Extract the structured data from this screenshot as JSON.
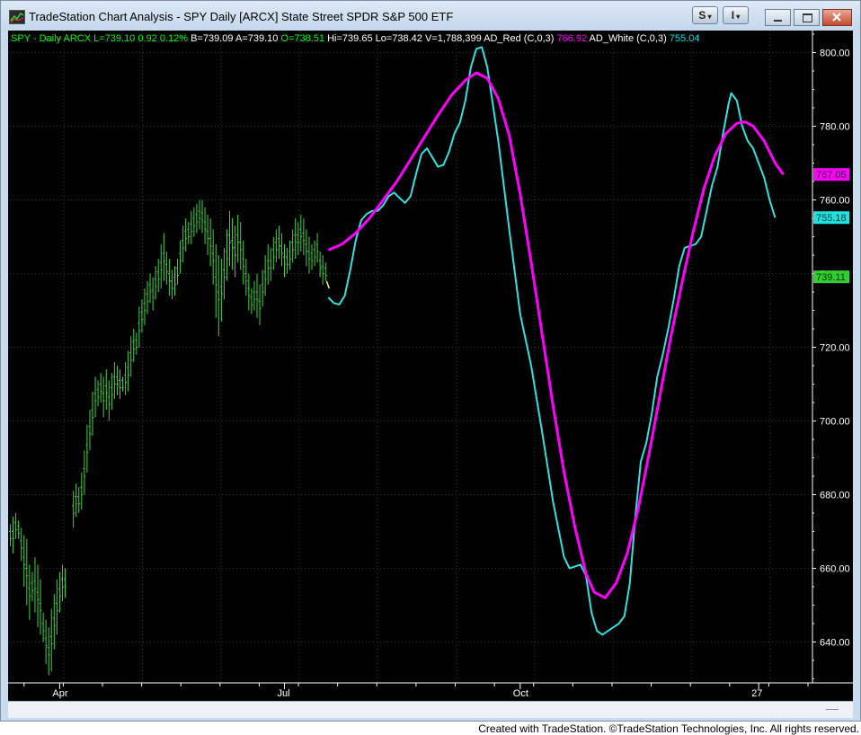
{
  "window": {
    "title": "TradeStation Chart Analysis - SPY Daily [ARCX] State Street SPDR S&P 500 ETF",
    "buttons": {
      "s_menu": "S",
      "i_menu": "I"
    }
  },
  "status_line": [
    {
      "text": "SPY - Daily",
      "color": "#00ff00"
    },
    {
      "text": "ARCX",
      "color": "#00ff00"
    },
    {
      "text": "L=739.10",
      "color": "#00ff00"
    },
    {
      "text": "0.92",
      "color": "#00ff00"
    },
    {
      "text": "0.12%",
      "color": "#00ff00"
    },
    {
      "text": "B=739.09",
      "color": "#ffffff"
    },
    {
      "text": "A=739.10",
      "color": "#ffffff"
    },
    {
      "text": "O=738.51",
      "color": "#00ff00"
    },
    {
      "text": "Hi=739.65",
      "color": "#ffffff"
    },
    {
      "text": "Lo=738.42",
      "color": "#ffffff"
    },
    {
      "text": "V=1,788,399",
      "color": "#ffffff"
    },
    {
      "text": "AD_Red (C,0,3)",
      "color": "#ffffff"
    },
    {
      "text": "766.92",
      "color": "#ff00ff"
    },
    {
      "text": "AD_White (C,0,3)",
      "color": "#ffffff"
    },
    {
      "text": "755.04",
      "color": "#00e5e5"
    }
  ],
  "credit": "Created with TradeStation. ©TradeStation Technologies, Inc. All rights reserved.",
  "colors": {
    "price": "#3fd43f",
    "last_bar": "#ffff66",
    "red": "#ff00ff",
    "white": "#33e0e0",
    "grid": "#1f3f3f"
  },
  "chart_data": {
    "type": "line",
    "symbol": "SPY",
    "interval": "Daily",
    "y_ticks": [
      800,
      780,
      760,
      740,
      720,
      700,
      680,
      660,
      640
    ],
    "y_tick_labels": [
      "800.00",
      "780.00",
      "760.00",
      "740.00",
      "720.00",
      "700.00",
      "680.00",
      "660.00",
      "640.00"
    ],
    "ylim": [
      628,
      806
    ],
    "x_ticks": [
      {
        "label": "Apr",
        "bar": 18
      },
      {
        "label": "Jul",
        "bar": 100
      },
      {
        "label": "Oct",
        "bar": 186
      },
      {
        "label": "27",
        "bar": 273
      }
    ],
    "xlim": [
      0,
      292
    ],
    "grid": true,
    "price_bars": [
      {
        "bar": 0,
        "high": 672,
        "low": 666
      },
      {
        "bar": 1,
        "high": 674,
        "low": 664
      },
      {
        "bar": 2,
        "high": 675,
        "low": 668
      },
      {
        "bar": 3,
        "high": 673,
        "low": 668
      },
      {
        "bar": 4,
        "high": 671,
        "low": 662
      },
      {
        "bar": 5,
        "high": 669,
        "low": 655
      },
      {
        "bar": 6,
        "high": 668,
        "low": 650
      },
      {
        "bar": 7,
        "high": 661,
        "low": 646
      },
      {
        "bar": 8,
        "high": 659,
        "low": 651
      },
      {
        "bar": 9,
        "high": 663,
        "low": 648
      },
      {
        "bar": 10,
        "high": 661,
        "low": 644
      },
      {
        "bar": 11,
        "high": 657,
        "low": 642
      },
      {
        "bar": 12,
        "high": 648,
        "low": 640
      },
      {
        "bar": 13,
        "high": 646,
        "low": 634
      },
      {
        "bar": 14,
        "high": 644,
        "low": 631
      },
      {
        "bar": 15,
        "high": 649,
        "low": 632
      },
      {
        "bar": 16,
        "high": 653,
        "low": 638
      },
      {
        "bar": 17,
        "high": 657,
        "low": 642
      },
      {
        "bar": 18,
        "high": 659,
        "low": 648
      },
      {
        "bar": 19,
        "high": 661,
        "low": 651
      },
      {
        "bar": 20,
        "high": 660,
        "low": 652
      },
      {
        "bar": 23,
        "high": 681,
        "low": 671
      },
      {
        "bar": 24,
        "high": 683,
        "low": 674
      },
      {
        "bar": 25,
        "high": 682,
        "low": 675
      },
      {
        "bar": 26,
        "high": 686,
        "low": 676
      },
      {
        "bar": 27,
        "high": 692,
        "low": 680
      },
      {
        "bar": 28,
        "high": 699,
        "low": 686
      },
      {
        "bar": 29,
        "high": 703,
        "low": 692
      },
      {
        "bar": 30,
        "high": 708,
        "low": 696
      },
      {
        "bar": 31,
        "high": 712,
        "low": 701
      },
      {
        "bar": 32,
        "high": 711,
        "low": 704
      },
      {
        "bar": 33,
        "high": 713,
        "low": 705
      },
      {
        "bar": 34,
        "high": 712,
        "low": 701
      },
      {
        "bar": 35,
        "high": 714,
        "low": 703
      },
      {
        "bar": 36,
        "high": 711,
        "low": 700
      },
      {
        "bar": 37,
        "high": 713,
        "low": 703
      },
      {
        "bar": 38,
        "high": 716,
        "low": 706
      },
      {
        "bar": 39,
        "high": 715,
        "low": 707
      },
      {
        "bar": 40,
        "high": 714,
        "low": 706
      },
      {
        "bar": 41,
        "high": 712,
        "low": 708
      },
      {
        "bar": 42,
        "high": 716,
        "low": 707
      },
      {
        "bar": 43,
        "high": 719,
        "low": 708
      },
      {
        "bar": 44,
        "high": 723,
        "low": 712
      },
      {
        "bar": 45,
        "high": 725,
        "low": 716
      },
      {
        "bar": 46,
        "high": 724,
        "low": 718
      },
      {
        "bar": 47,
        "high": 731,
        "low": 720
      },
      {
        "bar": 48,
        "high": 733,
        "low": 724
      },
      {
        "bar": 49,
        "high": 736,
        "low": 726
      },
      {
        "bar": 50,
        "high": 738,
        "low": 729
      },
      {
        "bar": 51,
        "high": 740,
        "low": 732
      },
      {
        "bar": 52,
        "high": 739,
        "low": 730
      },
      {
        "bar": 53,
        "high": 742,
        "low": 733
      },
      {
        "bar": 54,
        "high": 744,
        "low": 735
      },
      {
        "bar": 55,
        "high": 748,
        "low": 736
      },
      {
        "bar": 56,
        "high": 751,
        "low": 738
      },
      {
        "bar": 57,
        "high": 746,
        "low": 737
      },
      {
        "bar": 58,
        "high": 744,
        "low": 734
      },
      {
        "bar": 59,
        "high": 741,
        "low": 733
      },
      {
        "bar": 60,
        "high": 742,
        "low": 734
      },
      {
        "bar": 61,
        "high": 744,
        "low": 737
      },
      {
        "bar": 62,
        "high": 749,
        "low": 740
      },
      {
        "bar": 63,
        "high": 753,
        "low": 743
      },
      {
        "bar": 64,
        "high": 755,
        "low": 746
      },
      {
        "bar": 65,
        "high": 754,
        "low": 748
      },
      {
        "bar": 66,
        "high": 757,
        "low": 748
      },
      {
        "bar": 67,
        "high": 758,
        "low": 750
      },
      {
        "bar": 68,
        "high": 759,
        "low": 751
      },
      {
        "bar": 69,
        "high": 760,
        "low": 752
      },
      {
        "bar": 70,
        "high": 760,
        "low": 751
      },
      {
        "bar": 71,
        "high": 758,
        "low": 748
      },
      {
        "bar": 72,
        "high": 756,
        "low": 745
      },
      {
        "bar": 73,
        "high": 755,
        "low": 742
      },
      {
        "bar": 74,
        "high": 752,
        "low": 737
      },
      {
        "bar": 75,
        "high": 748,
        "low": 728
      },
      {
        "bar": 76,
        "high": 745,
        "low": 723
      },
      {
        "bar": 77,
        "high": 744,
        "low": 727
      },
      {
        "bar": 78,
        "high": 747,
        "low": 733
      },
      {
        "bar": 79,
        "high": 752,
        "low": 738
      },
      {
        "bar": 80,
        "high": 757,
        "low": 742
      },
      {
        "bar": 81,
        "high": 755,
        "low": 741
      },
      {
        "bar": 82,
        "high": 753,
        "low": 739
      },
      {
        "bar": 83,
        "high": 756,
        "low": 743
      },
      {
        "bar": 84,
        "high": 754,
        "low": 741
      },
      {
        "bar": 85,
        "high": 749,
        "low": 737
      },
      {
        "bar": 86,
        "high": 744,
        "low": 734
      },
      {
        "bar": 87,
        "high": 740,
        "low": 730
      },
      {
        "bar": 88,
        "high": 736,
        "low": 729
      },
      {
        "bar": 89,
        "high": 738,
        "low": 730
      },
      {
        "bar": 90,
        "high": 740,
        "low": 728
      },
      {
        "bar": 91,
        "high": 737,
        "low": 726
      },
      {
        "bar": 92,
        "high": 741,
        "low": 731
      },
      {
        "bar": 93,
        "high": 745,
        "low": 734
      },
      {
        "bar": 94,
        "high": 748,
        "low": 737
      },
      {
        "bar": 95,
        "high": 747,
        "low": 738
      },
      {
        "bar": 96,
        "high": 750,
        "low": 741
      },
      {
        "bar": 97,
        "high": 752,
        "low": 743
      },
      {
        "bar": 98,
        "high": 753,
        "low": 744
      },
      {
        "bar": 99,
        "high": 751,
        "low": 742
      },
      {
        "bar": 100,
        "high": 748,
        "low": 739
      },
      {
        "bar": 101,
        "high": 747,
        "low": 740
      },
      {
        "bar": 102,
        "high": 749,
        "low": 741
      },
      {
        "bar": 103,
        "high": 752,
        "low": 743
      },
      {
        "bar": 104,
        "high": 755,
        "low": 744
      },
      {
        "bar": 105,
        "high": 754,
        "low": 745
      },
      {
        "bar": 106,
        "high": 756,
        "low": 746
      },
      {
        "bar": 107,
        "high": 755,
        "low": 745
      },
      {
        "bar": 108,
        "high": 752,
        "low": 742
      },
      {
        "bar": 109,
        "high": 750,
        "low": 740
      },
      {
        "bar": 110,
        "high": 748,
        "low": 741
      },
      {
        "bar": 111,
        "high": 749,
        "low": 742
      },
      {
        "bar": 112,
        "high": 751,
        "low": 743
      },
      {
        "bar": 113,
        "high": 746,
        "low": 739
      },
      {
        "bar": 114,
        "high": 745,
        "low": 737
      },
      {
        "bar": 115,
        "high": 743,
        "low": 738
      }
    ],
    "last_bar": {
      "bar": 116,
      "high": 738,
      "low": 736
    },
    "series": [
      {
        "name": "AD_Red (C,0,3)",
        "last_value_label": "767.05",
        "points": [
          [
            116,
            746.4
          ],
          [
            121,
            748.0
          ],
          [
            126,
            751.0
          ],
          [
            131,
            755.0
          ],
          [
            136,
            760.0
          ],
          [
            141,
            765.0
          ],
          [
            146,
            771.0
          ],
          [
            151,
            777.0
          ],
          [
            156,
            783.0
          ],
          [
            161,
            788.5
          ],
          [
            166,
            792.5
          ],
          [
            170,
            794.5
          ],
          [
            174,
            793.0
          ],
          [
            178,
            787.5
          ],
          [
            182,
            777.5
          ],
          [
            186,
            761.5
          ],
          [
            190,
            743.0
          ],
          [
            194,
            723.5
          ],
          [
            198,
            704.0
          ],
          [
            202,
            686.0
          ],
          [
            206,
            671.0
          ],
          [
            210,
            658.5
          ],
          [
            213,
            653.5
          ],
          [
            217,
            652.0
          ],
          [
            221,
            656.0
          ],
          [
            225,
            664.0
          ],
          [
            229,
            676.0
          ],
          [
            233,
            691.0
          ],
          [
            237,
            707.0
          ],
          [
            241,
            723.0
          ],
          [
            245,
            737.5
          ],
          [
            249,
            751.0
          ],
          [
            253,
            763.0
          ],
          [
            257,
            772.0
          ],
          [
            261,
            778.0
          ],
          [
            265,
            780.8
          ],
          [
            268,
            781.2
          ],
          [
            271,
            780.0
          ],
          [
            275,
            776.0
          ],
          [
            279,
            770.0
          ],
          [
            282,
            766.9
          ]
        ]
      },
      {
        "name": "AD_White (C,0,3)",
        "last_value_label": "755.18",
        "points": [
          [
            116,
            733.5
          ],
          [
            118,
            732.0
          ],
          [
            120,
            731.6
          ],
          [
            122,
            734.0
          ],
          [
            124,
            741.0
          ],
          [
            126,
            749.0
          ],
          [
            128,
            754.5
          ],
          [
            130,
            756.2
          ],
          [
            132,
            757.0
          ],
          [
            134,
            757.0
          ],
          [
            136,
            758.5
          ],
          [
            138,
            761.0
          ],
          [
            140,
            762.0
          ],
          [
            142,
            760.5
          ],
          [
            144,
            759.2
          ],
          [
            146,
            761.0
          ],
          [
            148,
            767.0
          ],
          [
            150,
            772.5
          ],
          [
            152,
            774.0
          ],
          [
            154,
            771.5
          ],
          [
            156,
            769.0
          ],
          [
            158,
            769.5
          ],
          [
            160,
            773.0
          ],
          [
            162,
            778.0
          ],
          [
            164,
            781.0
          ],
          [
            166,
            787.0
          ],
          [
            168,
            796.0
          ],
          [
            170,
            801.0
          ],
          [
            172,
            801.5
          ],
          [
            174,
            796.0
          ],
          [
            176,
            786.0
          ],
          [
            178,
            776.0
          ],
          [
            182,
            752.0
          ],
          [
            186,
            729.0
          ],
          [
            190,
            715.0
          ],
          [
            194,
            697.0
          ],
          [
            198,
            678.0
          ],
          [
            202,
            663.0
          ],
          [
            204,
            660.0
          ],
          [
            206,
            660.5
          ],
          [
            208,
            661.0
          ],
          [
            210,
            658.0
          ],
          [
            212,
            648.0
          ],
          [
            214,
            643.0
          ],
          [
            216,
            642.0
          ],
          [
            218,
            643.0
          ],
          [
            220,
            644.0
          ],
          [
            222,
            645.0
          ],
          [
            224,
            647.0
          ],
          [
            226,
            656.0
          ],
          [
            228,
            674.0
          ],
          [
            230,
            689.0
          ],
          [
            232,
            694.0
          ],
          [
            234,
            702.0
          ],
          [
            236,
            712.0
          ],
          [
            238,
            718.0
          ],
          [
            240,
            725.0
          ],
          [
            242,
            733.0
          ],
          [
            244,
            742.0
          ],
          [
            246,
            747.0
          ],
          [
            248,
            747.5
          ],
          [
            250,
            748.0
          ],
          [
            252,
            750.0
          ],
          [
            254,
            757.0
          ],
          [
            256,
            764.0
          ],
          [
            258,
            769.0
          ],
          [
            260,
            778.0
          ],
          [
            262,
            786.0
          ],
          [
            263,
            789.0
          ],
          [
            265,
            787.0
          ],
          [
            267,
            780.0
          ],
          [
            269,
            776.0
          ],
          [
            271,
            774.0
          ],
          [
            273,
            770.0
          ],
          [
            275,
            766.0
          ],
          [
            277,
            760.0
          ],
          [
            279,
            755.2
          ]
        ]
      }
    ],
    "last_price_label": "739.11"
  }
}
